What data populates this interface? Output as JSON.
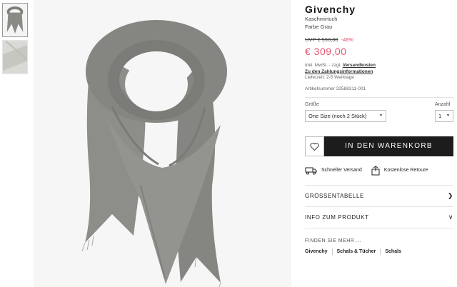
{
  "product": {
    "brand": "Givenchy",
    "name": "Kaschmirtuch",
    "color": "Farbe Grau",
    "uvp": "UVP € 590,00",
    "discount": "-48%",
    "price": "€ 309,00",
    "tax_note": "Inkl. MwSt. - zzgl.",
    "shipping_link": "Versandkosten",
    "payment_link": "Zu den Zahlungsinformationen",
    "delivery": "Lieferzeit: 2-5 Werktage",
    "article_number": "Artikelnummer 32588311-001"
  },
  "selectors": {
    "size_label": "Größe",
    "size_value": "One Size (noch 2 Stück)",
    "qty_label": "Anzahl",
    "qty_value": "1"
  },
  "actions": {
    "add_to_cart": "IN DEN WARENKORB",
    "wishlist_icon": "heart-icon"
  },
  "benefits": {
    "fast_shipping": "Schneller Versand",
    "free_returns": "Kostenlose Retoure"
  },
  "accordion": {
    "size_chart": "GRÖSSENTABELLE",
    "product_info": "INFO ZUM PRODUKT"
  },
  "find_more": {
    "title": "FINDEN SIE MEHR ...",
    "links": [
      "Givenchy",
      "Schals & Tücher",
      "Schals"
    ]
  },
  "colors": {
    "accent": "#e2536e",
    "button": "#1c1c1c",
    "scarf": "#8a8a86"
  }
}
